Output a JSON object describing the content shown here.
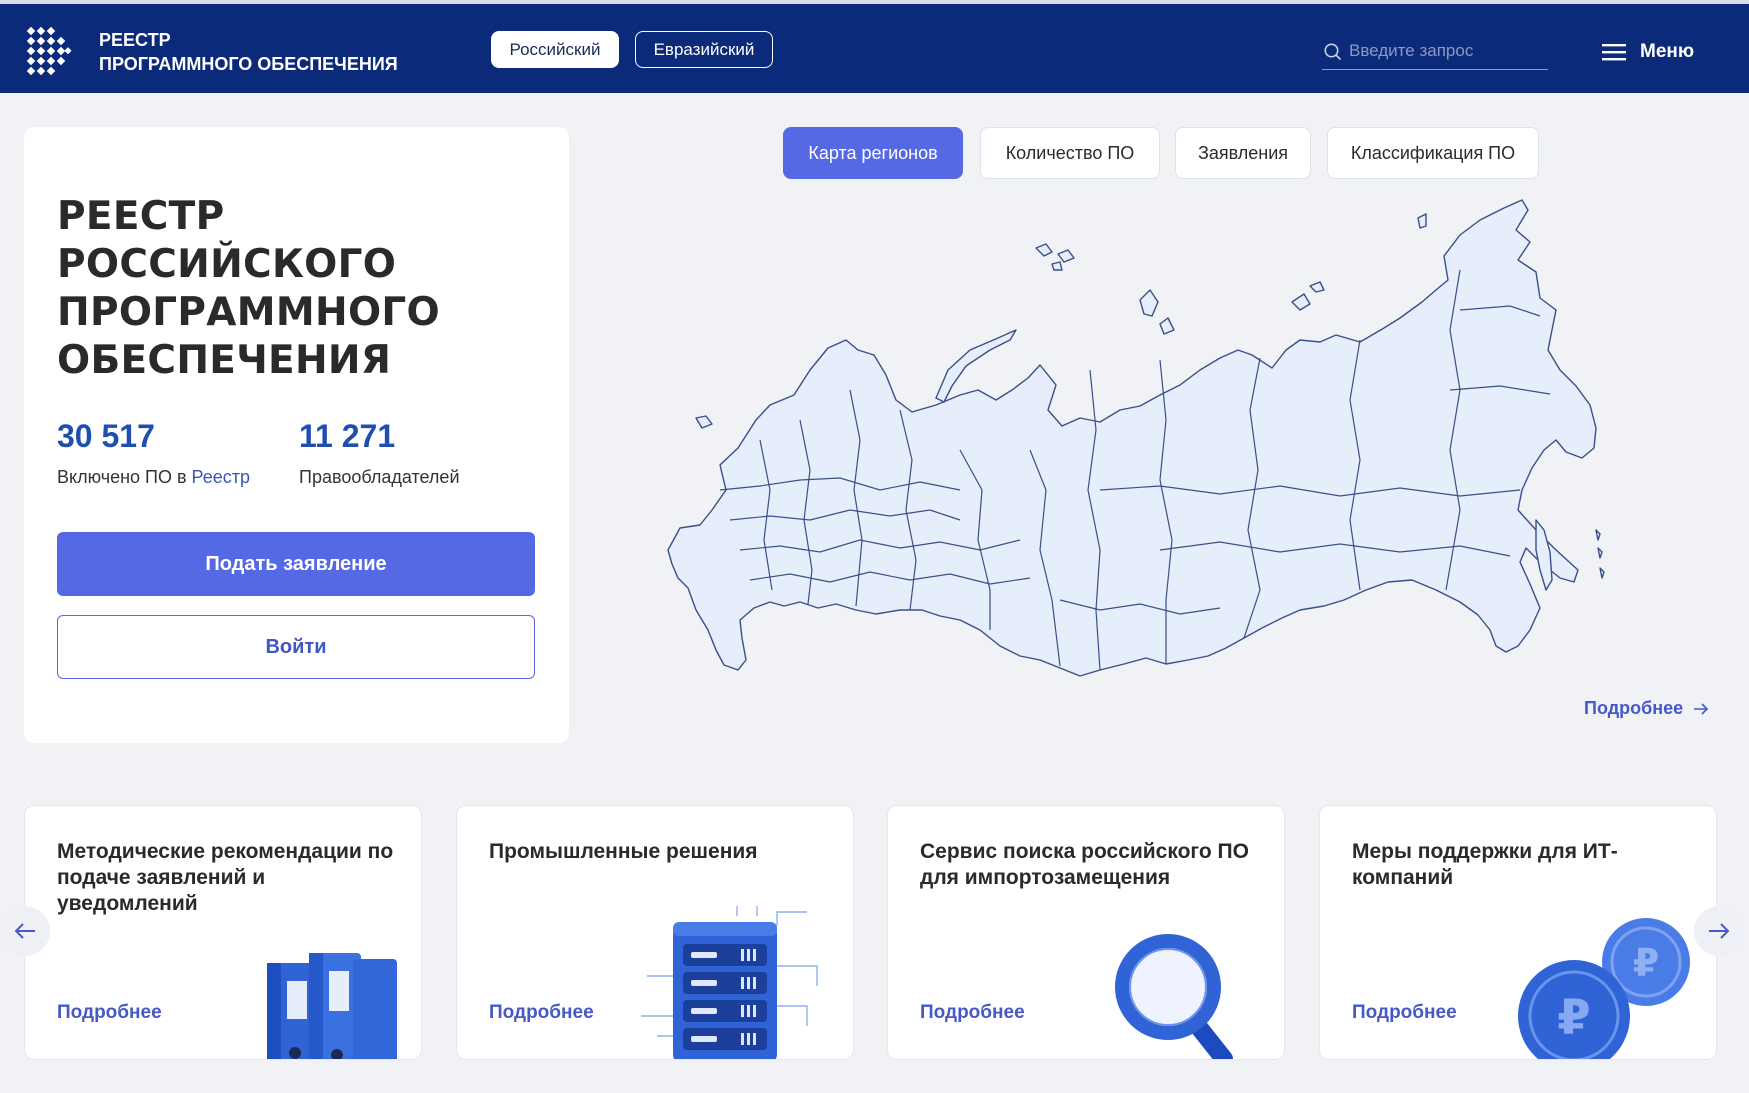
{
  "header": {
    "brand_line1": "РЕЕСТР",
    "brand_line2": "ПРОГРАММНОГО ОБЕСПЕЧЕНИЯ",
    "registry_switch": {
      "russian": "Российский",
      "eurasian": "Евразийский",
      "active": "Российский"
    },
    "search": {
      "placeholder": "Введите запрос",
      "value": ""
    },
    "menu_label": "Меню"
  },
  "hero": {
    "title_line1": "РЕЕСТР",
    "title_line2": "РОССИЙСКОГО",
    "title_line3": "ПРОГРАММНОГО",
    "title_line4": "ОБЕСПЕЧЕНИЯ",
    "stats": [
      {
        "value": "30 517",
        "label_prefix": "Включено ПО в ",
        "label_link": "Реестр"
      },
      {
        "value": "11 271",
        "label": "Правообладателей"
      }
    ],
    "submit_button": "Подать заявление",
    "login_button": "Войти"
  },
  "tabs": [
    {
      "label": "Карта регионов",
      "active": true
    },
    {
      "label": "Количество ПО",
      "active": false
    },
    {
      "label": "Заявления",
      "active": false
    },
    {
      "label": "Классификация ПО",
      "active": false
    }
  ],
  "map": {
    "fill": "#e6eefb",
    "stroke": "#3a4f88",
    "more_link": "Подробнее"
  },
  "cards": [
    {
      "title": "Методические рекомендации по подаче заявлений и уведомлений",
      "link": "Подробнее",
      "icon": "folders-icon"
    },
    {
      "title": "Промышленные решения",
      "link": "Подробнее",
      "icon": "server-icon"
    },
    {
      "title": "Сервис поиска российского ПО для импортозамещения",
      "link": "Подробнее",
      "icon": "magnifier-icon"
    },
    {
      "title": "Меры поддержки для ИТ-компаний",
      "link": "Подробнее",
      "icon": "ruble-coins-icon"
    }
  ],
  "colors": {
    "header_bg": "#0c2a7a",
    "accent": "#5469e3",
    "link": "#4759c6",
    "page_bg": "#f0f2f6"
  }
}
